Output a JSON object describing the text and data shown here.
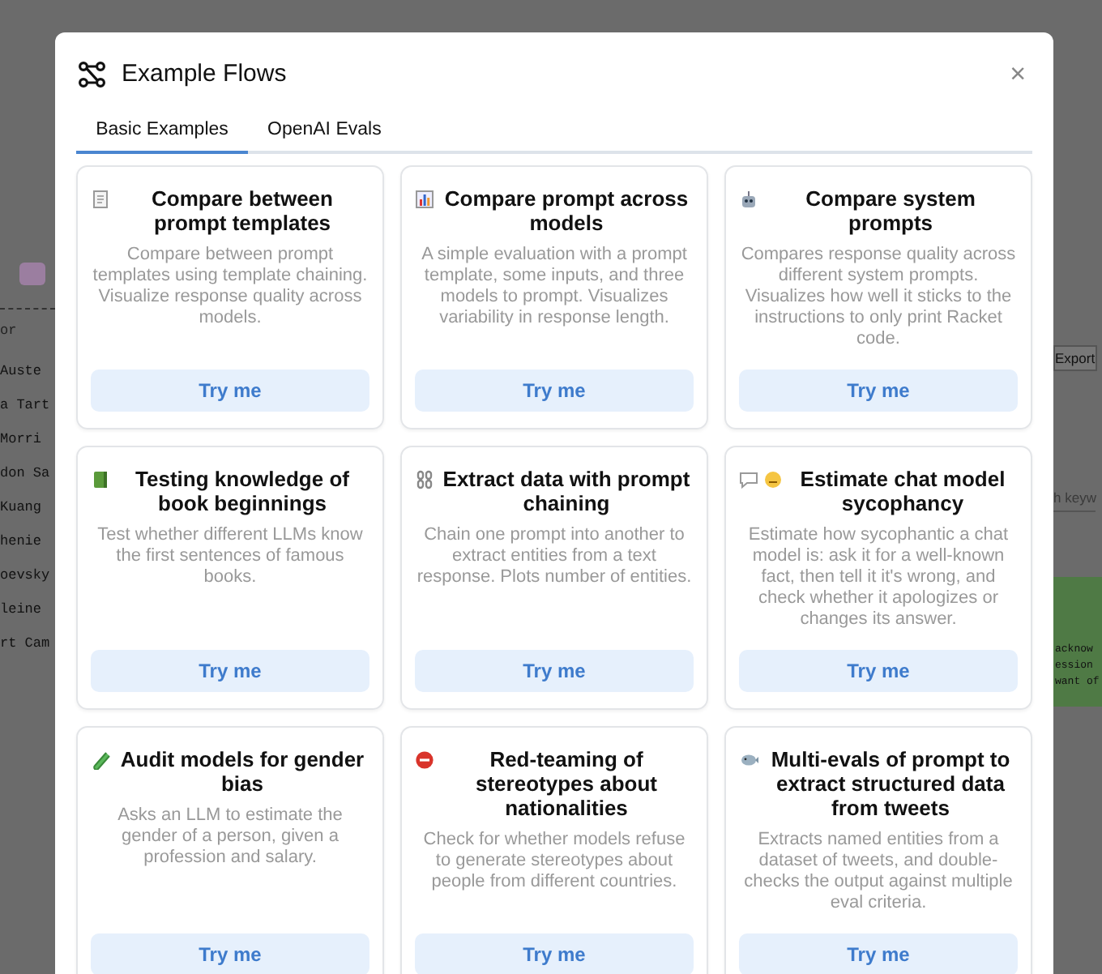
{
  "background": {
    "left_header": "or",
    "left_rows": [
      "Auste",
      "a Tart",
      "Morri",
      "don Sa",
      "Kuang",
      "henie",
      "oevsky",
      "leine",
      "rt Cam"
    ],
    "export_button": "Export",
    "search": {
      "placeholder": "h keyw"
    },
    "response_lines": [
      "acknow",
      "ession",
      "want of"
    ]
  },
  "dialog": {
    "title": "Example Flows",
    "close": "×",
    "tabs": [
      {
        "label": "Basic Examples",
        "selected": true
      },
      {
        "label": "OpenAI Evals",
        "selected": false
      }
    ],
    "cards": [
      {
        "title": "Compare between prompt templates",
        "description": "Compare between prompt templates using template chaining. Visualize response quality across models.",
        "button": "Try me"
      },
      {
        "title": "Compare prompt across models",
        "description": "A simple evaluation with a prompt template, some inputs, and three models to prompt. Visualizes variability in response length.",
        "button": "Try me"
      },
      {
        "title": "Compare system prompts",
        "description": "Compares response quality across different system prompts. Visualizes how well it sticks to the instructions to only print Racket code.",
        "button": "Try me"
      },
      {
        "title": "Testing knowledge of book beginnings",
        "description": "Test whether different LLMs know the first sentences of famous books.",
        "button": "Try me"
      },
      {
        "title": "Extract data with prompt chaining",
        "description": "Chain one prompt into another to extract entities from a text response. Plots number of entities.",
        "button": "Try me"
      },
      {
        "title": "Estimate chat model sycophancy",
        "description": "Estimate how sycophantic a chat model is: ask it for a well-known fact, then tell it it's wrong, and check whether it apologizes or changes its answer.",
        "button": "Try me"
      },
      {
        "title": "Audit models for gender bias",
        "description": "Asks an LLM to estimate the gender of a person, given a profession and salary.",
        "button": "Try me"
      },
      {
        "title": "Red-teaming of stereotypes about nationalities",
        "description": "Check for whether models refuse to generate stereotypes about people from different countries.",
        "button": "Try me"
      },
      {
        "title": "Multi-evals of prompt to extract structured data from tweets",
        "description": "Extracts named entities from a dataset of tweets, and double-checks the output against multiple eval criteria.",
        "button": "Try me"
      }
    ]
  }
}
